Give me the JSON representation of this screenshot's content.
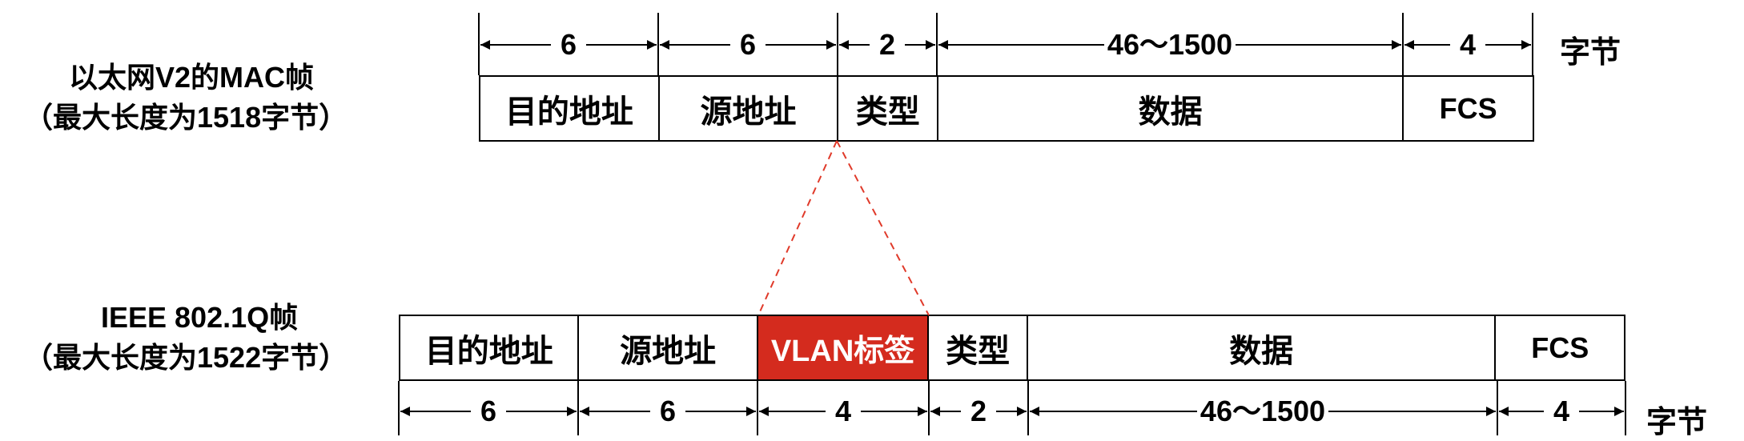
{
  "frame1": {
    "title_line1": "以太网V2的MAC帧",
    "title_line2": "（最大长度为1518字节）",
    "fields": [
      {
        "label": "目的地址",
        "size": "6"
      },
      {
        "label": "源地址",
        "size": "6"
      },
      {
        "label": "类型",
        "size": "2"
      },
      {
        "label": "数据",
        "size": "46～1500"
      },
      {
        "label": "FCS",
        "size": "4"
      }
    ],
    "unit": "字节"
  },
  "frame2": {
    "title_line1": "IEEE 802.1Q帧",
    "title_line2": "（最大长度为1522字节）",
    "fields": [
      {
        "label": "目的地址",
        "size": "6"
      },
      {
        "label": "源地址",
        "size": "6"
      },
      {
        "label": "VLAN标签",
        "size": "4",
        "highlight": true
      },
      {
        "label": "类型",
        "size": "2"
      },
      {
        "label": "数据",
        "size": "46～1500"
      },
      {
        "label": "FCS",
        "size": "4"
      }
    ],
    "unit": "字节"
  },
  "colors": {
    "accent": "#d42b1e",
    "dash": "#e03a2a",
    "line": "#000000"
  }
}
